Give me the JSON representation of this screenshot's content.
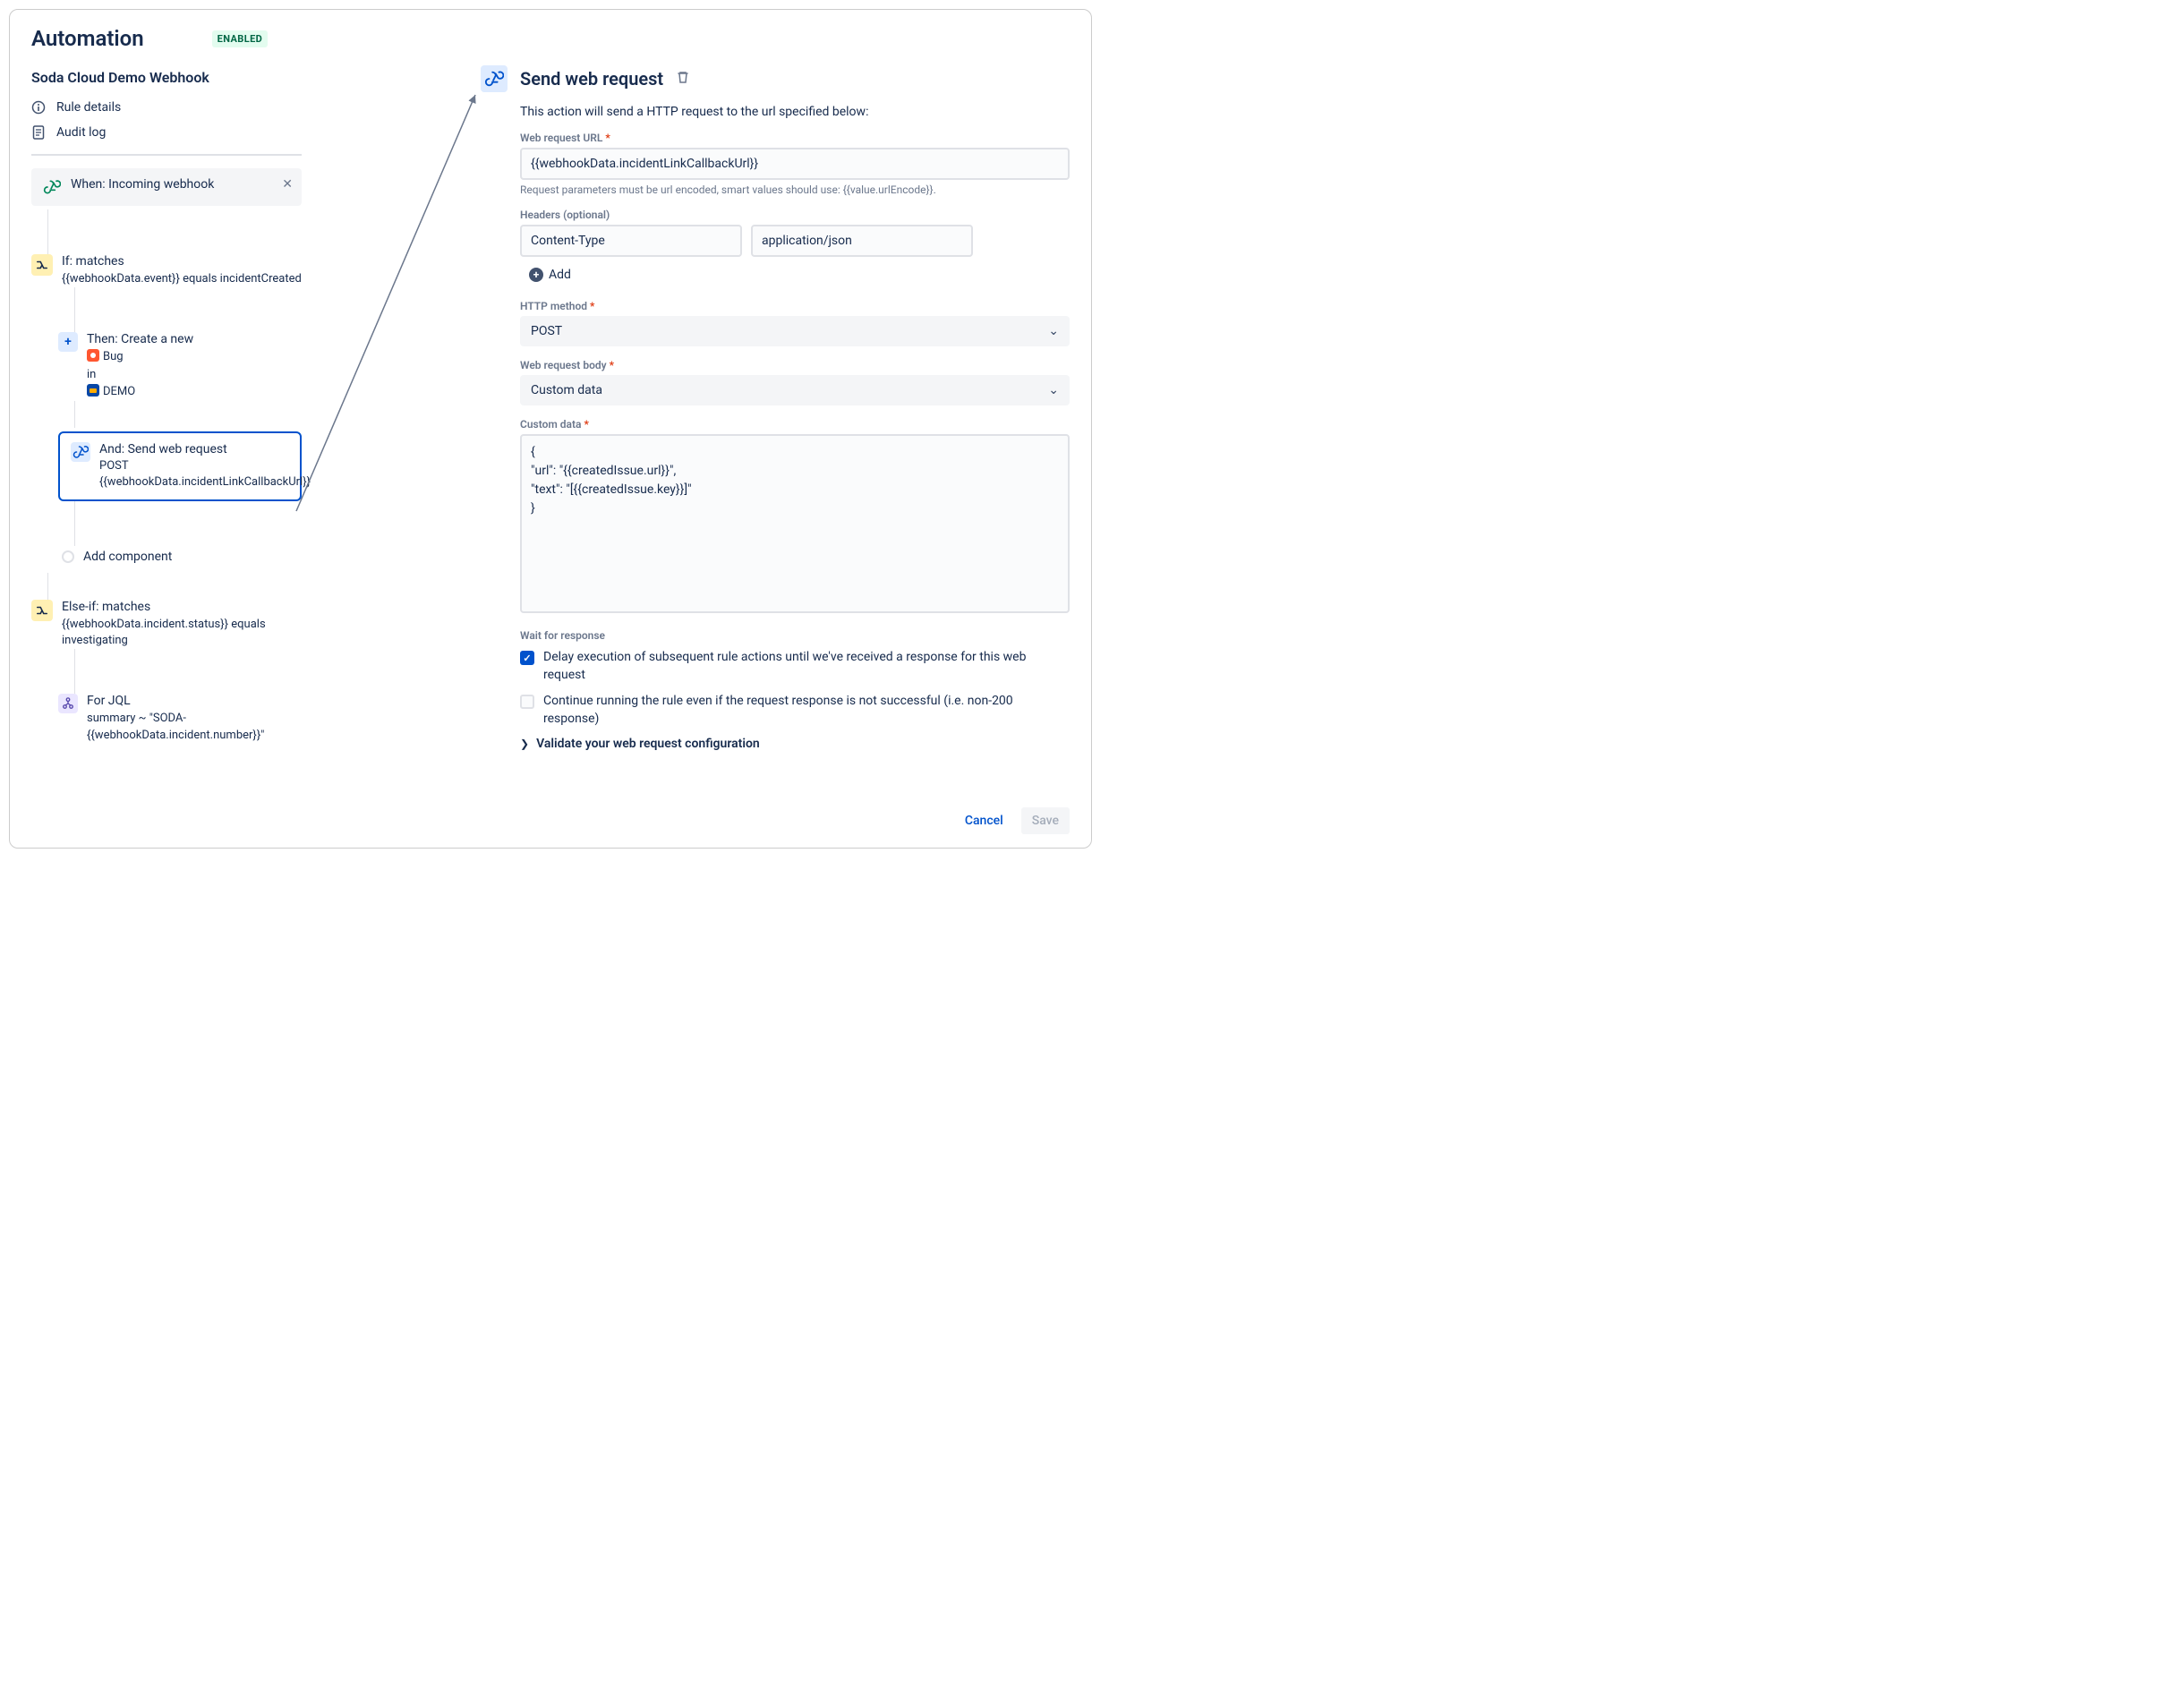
{
  "header": {
    "title": "Automation",
    "badge": "ENABLED",
    "rule_name": "Soda Cloud Demo Webhook"
  },
  "nav": {
    "details": "Rule details",
    "audit": "Audit log"
  },
  "flow": {
    "trigger": {
      "label": "When: Incoming webhook"
    },
    "if1": {
      "title": "If: matches",
      "sub": "{{webhookData.event}} equals incidentCreated"
    },
    "then1": {
      "title": "Then: Create a new",
      "bug_label": "Bug",
      "in_label": "in",
      "project_label": "DEMO"
    },
    "and1": {
      "title": "And: Send web request",
      "method": "POST",
      "url": "{{webhookData.incidentLinkCallbackUrl}}"
    },
    "add_component": "Add component",
    "elseif": {
      "title": "Else-if: matches",
      "sub": "{{webhookData.incident.status}} equals investigating"
    },
    "for": {
      "title": "For JQL",
      "sub": "summary ~ \"SODA-{{webhookData.incident.number}}\""
    }
  },
  "detail": {
    "title": "Send web request",
    "desc": "This action will send a HTTP request to the url specified below:",
    "url_label": "Web request URL",
    "url_value": "{{webhookData.incidentLinkCallbackUrl}}",
    "url_hint": "Request parameters must be url encoded, smart values should use: {{value.urlEncode}}.",
    "headers_label": "Headers (optional)",
    "header_key": "Content-Type",
    "header_val": "application/json",
    "add_label": "Add",
    "method_label": "HTTP method",
    "method_value": "POST",
    "body_label": "Web request body",
    "body_value": "Custom data",
    "custom_label": "Custom data",
    "custom_value": "{\n\"url\": \"{{createdIssue.url}}\",\n\"text\": \"[{{createdIssue.key}}]\"\n}",
    "wait_label": "Wait for response",
    "delay_label": "Delay execution of subsequent rule actions until we've received a response for this web request",
    "continue_label": "Continue running the rule even if the request response is not successful (i.e. non-200 response)",
    "validate_label": "Validate your web request configuration",
    "cancel": "Cancel",
    "save": "Save"
  }
}
